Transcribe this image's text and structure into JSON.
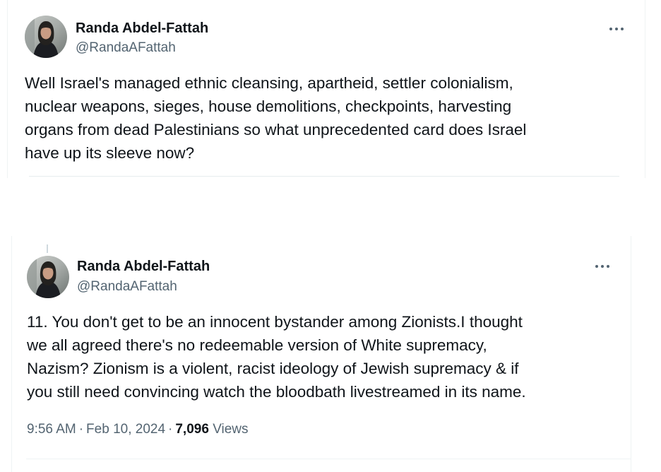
{
  "tweets": [
    {
      "author": {
        "name": "Randa Abdel-Fattah",
        "handle": "@RandaAFattah"
      },
      "text_lines": [
        "Well Israel's managed ethnic cleansing, apartheid, settler colonialism,",
        "nuclear weapons, sieges, house demolitions, checkpoints, harvesting",
        "organs from dead Palestinians so what unprecedented card does Israel",
        "have up its sleeve now?"
      ]
    },
    {
      "author": {
        "name": "Randa Abdel-Fattah",
        "handle": "@RandaAFattah"
      },
      "text_lines": [
        "11. You don't get to be an innocent bystander among Zionists.I thought",
        "we all agreed  there's no redeemable version of White supremacy,",
        "Nazism? Zionism is a violent, racist ideology of Jewish supremacy & if",
        "you still need convincing watch the bloodbath livestreamed in its name."
      ],
      "meta": {
        "time": "9:56 AM",
        "separator": "·",
        "date": "Feb 10, 2024",
        "views_count": "7,096",
        "views_label": "Views"
      }
    }
  ],
  "icons": {
    "more": "more-options-icon",
    "avatar": "profile-photo"
  },
  "colors": {
    "text_primary": "#0f1419",
    "text_secondary": "#536471",
    "divider": "#eff3f4"
  }
}
